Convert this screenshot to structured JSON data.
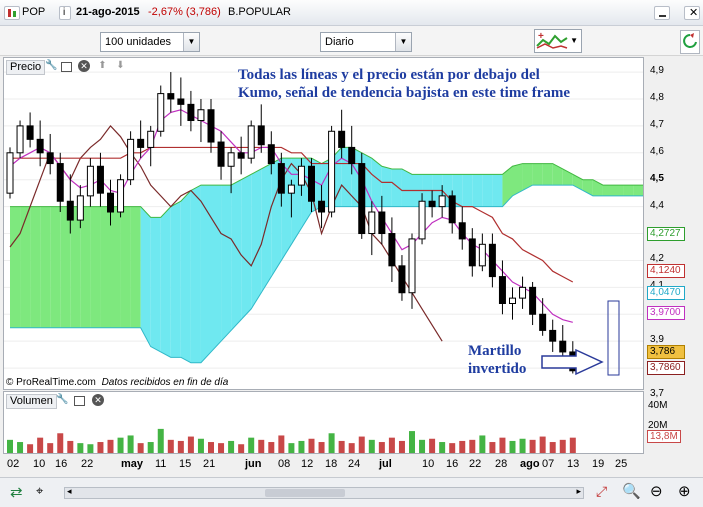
{
  "titlebar": {
    "symbol": "POP",
    "date": "21-ago-2015",
    "change": "-2,67% (3,786)",
    "name": "B.POPULAR"
  },
  "toolbar": {
    "units_value": "100 unidades",
    "period_value": "Diario"
  },
  "price_panel": {
    "label": "Precio",
    "annotation_line1": "Todas las líneas y el precio están por debajo del",
    "annotation_line2": "Kumo, señal de tendencia bajista en este time frame",
    "callout_line1": "Martillo",
    "callout_line2": "invertido",
    "footer": "© ProRealTime.com",
    "footer_italic": "Datos recibidos en fin de día",
    "y_ticks": [
      "4,9",
      "4,8",
      "4,7",
      "4,6",
      "4,5",
      "4,4",
      "4,3",
      "4,2",
      "4,1",
      "4,0",
      "3,9",
      "3,8",
      "3,7"
    ],
    "price_tags": [
      {
        "text": "4,2727",
        "color": "#2e9e2e"
      },
      {
        "text": "4,1240",
        "color": "#c03030"
      },
      {
        "text": "4,0470",
        "color": "#20a8c8"
      },
      {
        "text": "3,9700",
        "color": "#c030c0"
      },
      {
        "text": "3,786",
        "color": "#000000",
        "bg": "#f0c040"
      },
      {
        "text": "3,7860",
        "color": "#8b2020"
      }
    ]
  },
  "volume_panel": {
    "label": "Volumen",
    "y_ticks": [
      "40M",
      "20M"
    ],
    "last_tag": "13,8M"
  },
  "x_axis": {
    "ticks": [
      "02",
      "10",
      "16",
      "22",
      "may",
      "11",
      "15",
      "21",
      "jun",
      "08",
      "12",
      "18",
      "24",
      "jul",
      "10",
      "16",
      "22",
      "28",
      "ago",
      "07",
      "13",
      "19",
      "25"
    ]
  },
  "colors": {
    "kumo_bull": "#7ee87e",
    "kumo_bear": "#6fe8f0",
    "tenkan": "#c030c0",
    "kijun": "#b03030",
    "chikou": "#7a2a2a",
    "annotation": "#1e3ca0",
    "vol_up": "#44b444",
    "vol_down": "#c84848"
  },
  "chart_data": {
    "type": "candlestick",
    "ylim": [
      3.7,
      4.93
    ],
    "candles": [
      [
        4.45,
        4.62,
        4.43,
        4.6
      ],
      [
        4.6,
        4.72,
        4.58,
        4.7
      ],
      [
        4.7,
        4.75,
        4.62,
        4.65
      ],
      [
        4.65,
        4.72,
        4.55,
        4.6
      ],
      [
        4.6,
        4.67,
        4.52,
        4.56
      ],
      [
        4.56,
        4.6,
        4.38,
        4.42
      ],
      [
        4.42,
        4.52,
        4.3,
        4.35
      ],
      [
        4.35,
        4.48,
        4.32,
        4.44
      ],
      [
        4.44,
        4.58,
        4.4,
        4.55
      ],
      [
        4.55,
        4.6,
        4.4,
        4.45
      ],
      [
        4.45,
        4.5,
        4.33,
        4.38
      ],
      [
        4.38,
        4.52,
        4.36,
        4.5
      ],
      [
        4.5,
        4.68,
        4.48,
        4.65
      ],
      [
        4.65,
        4.72,
        4.58,
        4.62
      ],
      [
        4.62,
        4.7,
        4.55,
        4.68
      ],
      [
        4.68,
        4.85,
        4.66,
        4.82
      ],
      [
        4.82,
        4.9,
        4.75,
        4.8
      ],
      [
        4.8,
        4.88,
        4.7,
        4.78
      ],
      [
        4.78,
        4.83,
        4.68,
        4.72
      ],
      [
        4.72,
        4.8,
        4.64,
        4.76
      ],
      [
        4.76,
        4.8,
        4.6,
        4.64
      ],
      [
        4.64,
        4.68,
        4.5,
        4.55
      ],
      [
        4.55,
        4.62,
        4.45,
        4.6
      ],
      [
        4.6,
        4.66,
        4.52,
        4.58
      ],
      [
        4.58,
        4.72,
        4.56,
        4.7
      ],
      [
        4.7,
        4.78,
        4.6,
        4.63
      ],
      [
        4.63,
        4.68,
        4.52,
        4.56
      ],
      [
        4.56,
        4.6,
        4.4,
        4.45
      ],
      [
        4.45,
        4.5,
        4.36,
        4.48
      ],
      [
        4.48,
        4.58,
        4.44,
        4.55
      ],
      [
        4.55,
        4.58,
        4.38,
        4.42
      ],
      [
        4.42,
        4.48,
        4.32,
        4.38
      ],
      [
        4.38,
        4.7,
        4.36,
        4.68
      ],
      [
        4.68,
        4.76,
        4.58,
        4.62
      ],
      [
        4.62,
        4.7,
        4.52,
        4.56
      ],
      [
        4.56,
        4.6,
        4.28,
        4.3
      ],
      [
        4.3,
        4.42,
        4.22,
        4.38
      ],
      [
        4.38,
        4.44,
        4.26,
        4.3
      ],
      [
        4.3,
        4.36,
        4.12,
        4.18
      ],
      [
        4.18,
        4.22,
        4.05,
        4.08
      ],
      [
        4.08,
        4.3,
        4.02,
        4.28
      ],
      [
        4.28,
        4.45,
        4.26,
        4.42
      ],
      [
        4.42,
        4.46,
        4.36,
        4.4
      ],
      [
        4.4,
        4.48,
        4.36,
        4.44
      ],
      [
        4.44,
        4.46,
        4.3,
        4.34
      ],
      [
        4.34,
        4.4,
        4.24,
        4.28
      ],
      [
        4.28,
        4.32,
        4.14,
        4.18
      ],
      [
        4.18,
        4.3,
        4.16,
        4.26
      ],
      [
        4.26,
        4.3,
        4.1,
        4.14
      ],
      [
        4.14,
        4.2,
        4.0,
        4.04
      ],
      [
        4.04,
        4.1,
        3.98,
        4.06
      ],
      [
        4.06,
        4.14,
        4.02,
        4.1
      ],
      [
        4.1,
        4.12,
        3.96,
        4.0
      ],
      [
        4.0,
        4.06,
        3.92,
        3.94
      ],
      [
        3.94,
        3.98,
        3.86,
        3.9
      ],
      [
        3.9,
        3.96,
        3.84,
        3.86
      ],
      [
        3.86,
        3.9,
        3.78,
        3.79
      ]
    ],
    "volume_values": [
      12,
      10,
      8,
      14,
      9,
      18,
      11,
      9,
      8,
      10,
      12,
      14,
      16,
      9,
      10,
      22,
      12,
      11,
      15,
      13,
      10,
      9,
      11,
      8,
      14,
      12,
      10,
      16,
      9,
      11,
      13,
      10,
      18,
      11,
      9,
      15,
      12,
      10,
      14,
      11,
      20,
      12,
      13,
      10,
      9,
      11,
      12,
      16,
      10,
      14,
      11,
      13,
      12,
      15,
      10,
      12,
      14
    ],
    "volume_up": [
      1,
      1,
      0,
      0,
      0,
      0,
      0,
      1,
      1,
      0,
      0,
      1,
      1,
      0,
      1,
      1,
      0,
      0,
      0,
      1,
      0,
      0,
      1,
      0,
      1,
      0,
      0,
      0,
      1,
      1,
      0,
      0,
      1,
      0,
      0,
      0,
      1,
      0,
      0,
      0,
      1,
      1,
      0,
      1,
      0,
      0,
      0,
      1,
      0,
      0,
      1,
      1,
      0,
      0,
      0,
      0,
      0
    ],
    "vol_ylim": [
      0,
      52
    ],
    "tenkan": [
      4.55,
      4.58,
      4.6,
      4.62,
      4.6,
      4.55,
      4.5,
      4.47,
      4.48,
      4.5,
      4.46,
      4.45,
      4.52,
      4.58,
      4.62,
      4.72,
      4.75,
      4.76,
      4.74,
      4.72,
      4.7,
      4.68,
      4.64,
      4.6,
      4.6,
      4.62,
      4.62,
      4.56,
      4.52,
      4.52,
      4.5,
      4.48,
      4.55,
      4.58,
      4.56,
      4.5,
      4.42,
      4.36,
      4.3,
      4.24,
      4.26,
      4.3,
      4.34,
      4.36,
      4.35,
      4.3,
      4.26,
      4.24,
      4.2,
      4.16,
      4.12,
      4.1,
      4.08,
      4.04,
      4.0,
      3.98,
      3.97
    ],
    "kijun": [
      4.58,
      4.58,
      4.58,
      4.58,
      4.58,
      4.58,
      4.58,
      4.58,
      4.58,
      4.58,
      4.58,
      4.58,
      4.6,
      4.6,
      4.62,
      4.62,
      4.62,
      4.62,
      4.62,
      4.62,
      4.62,
      4.62,
      4.62,
      4.62,
      4.62,
      4.62,
      4.62,
      4.62,
      4.6,
      4.6,
      4.56,
      4.56,
      4.56,
      4.56,
      4.56,
      4.56,
      4.52,
      4.49,
      4.49,
      4.46,
      4.46,
      4.46,
      4.46,
      4.46,
      4.42,
      4.4,
      4.4,
      4.38,
      4.36,
      4.3,
      4.28,
      4.24,
      4.22,
      4.2,
      4.16,
      4.14,
      4.12
    ],
    "chikou": [
      4.25,
      4.3,
      4.4,
      4.5,
      4.6,
      4.55,
      4.5,
      4.58,
      4.62,
      4.65,
      4.7,
      4.66,
      4.6,
      4.55,
      4.48,
      4.44,
      4.4,
      4.44,
      4.46,
      4.42,
      4.36,
      4.3,
      4.28,
      4.22,
      4.18,
      4.26,
      4.4,
      4.5,
      4.56,
      4.52,
      4.45,
      4.3,
      4.4,
      4.48,
      4.44,
      4.4,
      4.3,
      4.26,
      4.2,
      4.14,
      4.08,
      4.02,
      3.96,
      3.9
    ],
    "kumo_top": [
      4.4,
      4.4,
      4.4,
      4.4,
      4.4,
      4.4,
      4.4,
      4.4,
      4.4,
      4.4,
      4.4,
      4.4,
      4.4,
      4.4,
      4.36,
      4.36,
      4.4,
      4.42,
      4.46,
      4.48,
      4.48,
      4.48,
      4.48,
      4.5,
      4.52,
      4.54,
      4.56,
      4.58,
      4.58,
      4.58,
      4.58,
      4.56,
      4.58,
      4.62,
      4.62,
      4.6,
      4.58,
      4.55,
      4.54,
      4.54,
      4.52,
      4.52,
      4.52,
      4.52,
      4.52,
      4.52,
      4.52,
      4.52,
      4.52,
      4.52,
      4.55,
      4.56,
      4.56,
      4.56,
      4.56,
      4.54,
      4.52,
      4.5,
      4.5,
      4.48,
      4.48,
      4.48,
      4.48,
      4.48,
      4.48,
      4.48,
      4.48,
      4.48,
      4.48,
      4.48,
      4.48,
      4.48,
      4.48,
      4.48
    ],
    "kumo_bottom": [
      3.95,
      3.95,
      3.95,
      3.95,
      3.95,
      3.95,
      3.95,
      3.95,
      3.95,
      3.95,
      3.95,
      3.95,
      3.95,
      3.95,
      3.88,
      3.86,
      3.84,
      3.84,
      3.82,
      3.82,
      3.86,
      3.9,
      3.94,
      3.98,
      4.02,
      4.08,
      4.14,
      4.2,
      4.26,
      4.32,
      4.38,
      4.4,
      4.4,
      4.4,
      4.4,
      4.4,
      4.4,
      4.4,
      4.4,
      4.4,
      4.4,
      4.4,
      4.4,
      4.4,
      4.4,
      4.4,
      4.4,
      4.4,
      4.4,
      4.4,
      4.44,
      4.46,
      4.48,
      4.48,
      4.48,
      4.48,
      4.48,
      4.46,
      4.44,
      4.44,
      4.44,
      4.44,
      4.44,
      4.44,
      4.44,
      4.44,
      4.44,
      4.44,
      4.4,
      4.38,
      4.36,
      4.38,
      4.4,
      4.4
    ]
  }
}
